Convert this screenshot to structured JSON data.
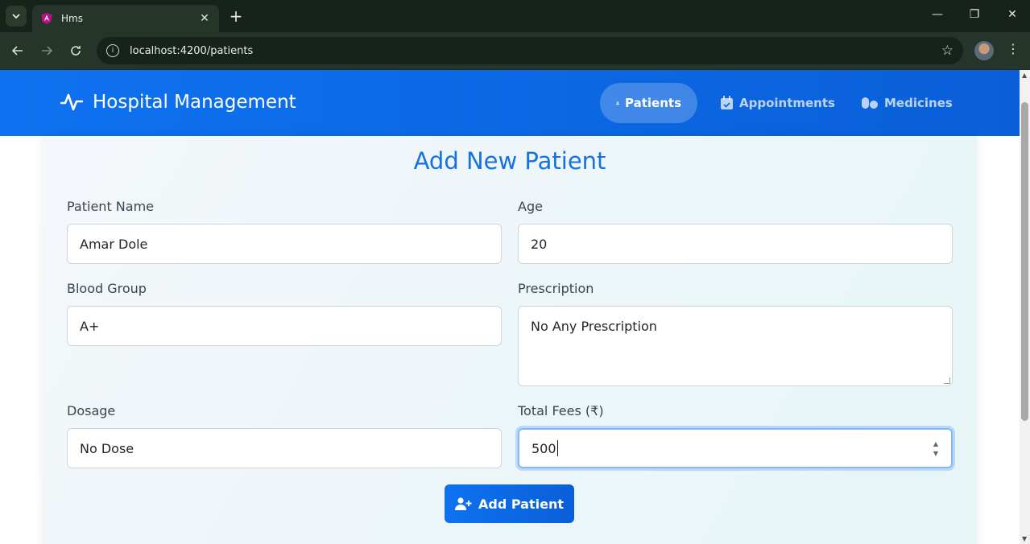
{
  "browser": {
    "tab_title": "Hms",
    "url": "localhost:4200/patients"
  },
  "navbar": {
    "brand": "Hospital Management",
    "items": [
      {
        "label": "Patients",
        "icon": "user-doctor-icon",
        "active": true
      },
      {
        "label": "Appointments",
        "icon": "calendar-check-icon",
        "active": false
      },
      {
        "label": "Medicines",
        "icon": "pills-icon",
        "active": false
      }
    ]
  },
  "form": {
    "title": "Add New Patient",
    "patient_name_label": "Patient Name",
    "patient_name_value": "Amar Dole",
    "age_label": "Age",
    "age_value": "20",
    "blood_group_label": "Blood Group",
    "blood_group_value": "A+",
    "prescription_label": "Prescription",
    "prescription_value": "No Any Prescription",
    "dosage_label": "Dosage",
    "dosage_value": "No Dose",
    "fees_label": "Total Fees (₹)",
    "fees_value": "500",
    "submit_label": "Add Patient"
  },
  "colors": {
    "accent": "#0e72f0",
    "title": "#1572e0"
  }
}
